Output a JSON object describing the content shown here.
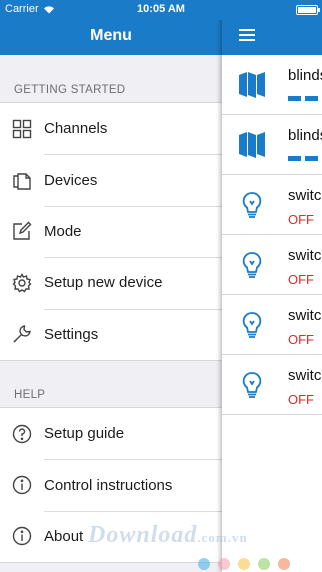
{
  "status_bar": {
    "carrier": "Carrier",
    "time": "10:05 AM"
  },
  "menu": {
    "title": "Menu",
    "sections": [
      {
        "title": "GETTING STARTED",
        "items": [
          {
            "label": "Channels",
            "icon": "grid-icon"
          },
          {
            "label": "Devices",
            "icon": "copy-icon"
          },
          {
            "label": "Mode",
            "icon": "edit-icon"
          },
          {
            "label": "Setup new device",
            "icon": "gear-icon"
          },
          {
            "label": "Settings",
            "icon": "wrench-icon"
          }
        ]
      },
      {
        "title": "HELP",
        "items": [
          {
            "label": "Setup guide",
            "icon": "question-icon"
          },
          {
            "label": "Control instructions",
            "icon": "info-icon"
          },
          {
            "label": "About",
            "icon": "info-icon"
          }
        ]
      }
    ]
  },
  "devices": [
    {
      "name": "blinds",
      "type": "blind",
      "status": ""
    },
    {
      "name": "blinds",
      "type": "blind",
      "status": ""
    },
    {
      "name": "switch",
      "type": "switch",
      "status": "OFF"
    },
    {
      "name": "switch",
      "type": "switch",
      "status": "OFF"
    },
    {
      "name": "switch",
      "type": "switch",
      "status": "OFF"
    },
    {
      "name": "switch",
      "type": "switch",
      "status": "OFF"
    }
  ],
  "colors": {
    "accent": "#1a7cc8",
    "off": "#e0262b",
    "background": "#efeff4"
  },
  "watermark": {
    "text": "Download",
    "suffix": ".com.vn"
  }
}
